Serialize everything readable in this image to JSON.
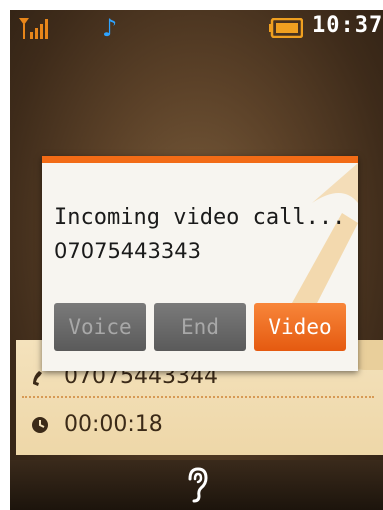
{
  "status_bar": {
    "time": "10:37",
    "icons": [
      "signal-icon",
      "music-icon",
      "battery-icon"
    ]
  },
  "dialog": {
    "title": "Incoming video call...",
    "number": "07075443343",
    "buttons": {
      "voice": "Voice",
      "end": "End",
      "video": "Video"
    }
  },
  "history": {
    "number": "07075443344",
    "duration": "00:00:18",
    "icons": [
      "phone-icon",
      "clock-icon"
    ]
  },
  "bottom_bar": {
    "icon": "ear-icon"
  },
  "colors": {
    "accent": "#f26b16",
    "music_icon": "#2ea3ff",
    "signal_icon": "#e8861a",
    "battery_icon": "#f0a020"
  }
}
